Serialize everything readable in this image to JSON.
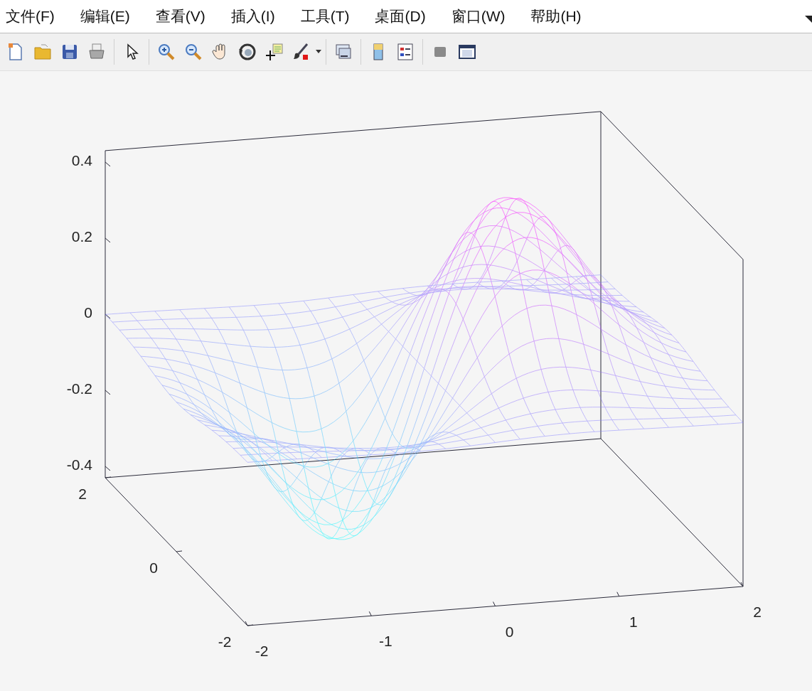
{
  "menu": [
    "文件(F)",
    "编辑(E)",
    "查看(V)",
    "插入(I)",
    "工具(T)",
    "桌面(D)",
    "窗口(W)",
    "帮助(H)"
  ],
  "axes": {
    "z_ticks": [
      "0.4",
      "0.2",
      "0",
      "-0.2",
      "-0.4"
    ],
    "y_ticks": [
      "2",
      "0",
      "-2"
    ],
    "x_ticks": [
      "-2",
      "-1",
      "0",
      "1",
      "2"
    ]
  }
}
